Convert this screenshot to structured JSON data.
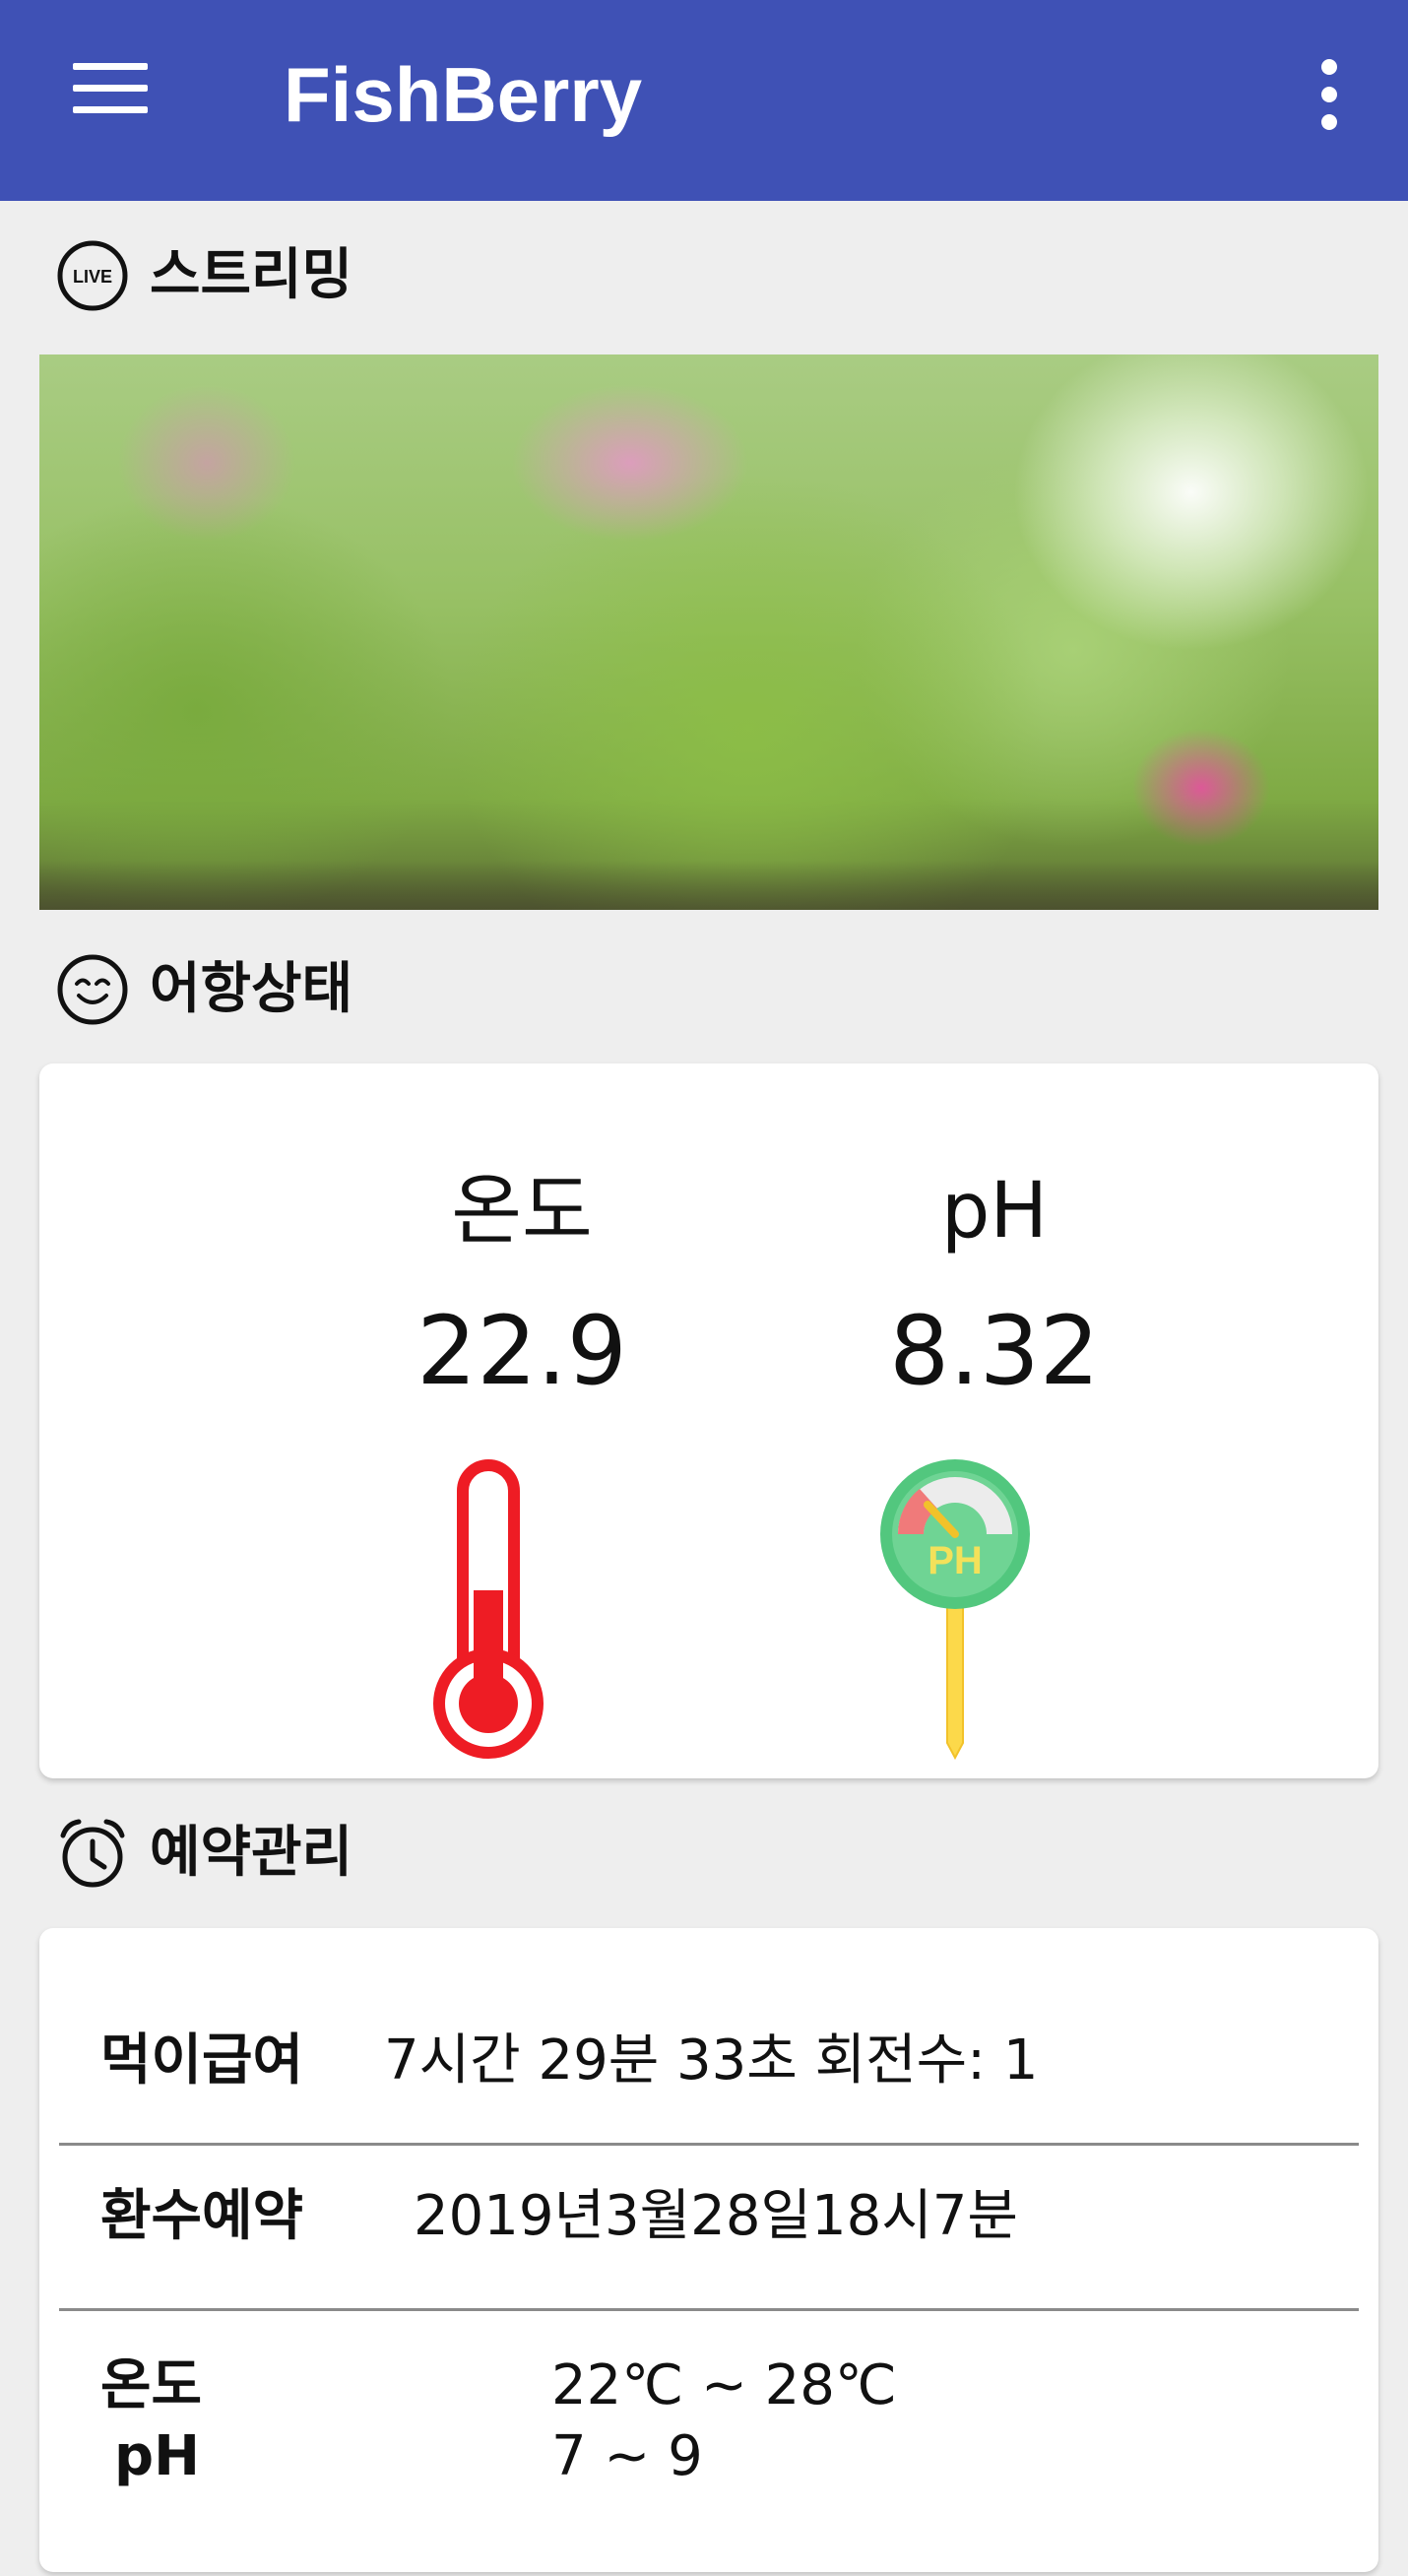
{
  "app": {
    "title": "FishBerry",
    "primary_color": "#3f51b5",
    "menu_icon": "hamburger-menu-icon",
    "more_icon": "more-vert-icon"
  },
  "sections": {
    "streaming": {
      "label": "스트리밍",
      "icon": "live-icon"
    },
    "status": {
      "label": "어항상태",
      "icon": "smiley-icon"
    },
    "schedule": {
      "label": "예약관리",
      "icon": "alarm-clock-icon"
    }
  },
  "live_badge": "LIVE",
  "tank_status": {
    "temperature": {
      "label": "온도",
      "value": "22.9",
      "icon": "thermometer-icon",
      "fill_fraction": 0.5,
      "color": "#ee1c24"
    },
    "ph": {
      "label": "pH",
      "value": "8.32",
      "icon": "ph-meter-icon",
      "icon_text": "PH"
    }
  },
  "schedule": {
    "feeding": {
      "label": "먹이급여",
      "value": "7시간 29분 33초  회전수: 1"
    },
    "water_change": {
      "label": "환수예약",
      "value": "2019년3월28일18시7분"
    },
    "ranges": {
      "temp_label": "온도",
      "temp_value": "22℃ ~ 28℃",
      "ph_label": "pH",
      "ph_value": "7 ~ 9"
    }
  }
}
